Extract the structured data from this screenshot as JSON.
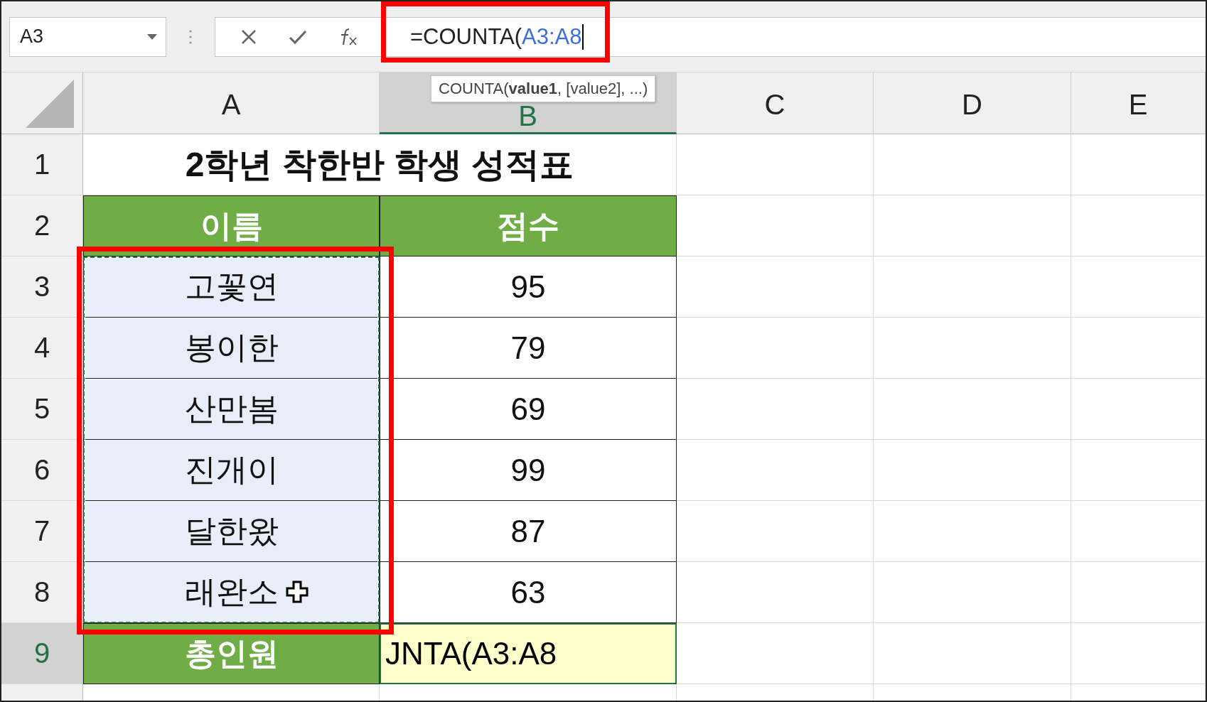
{
  "name_box": {
    "value": "A3"
  },
  "formula_bar": {
    "prefix": "=COUNTA(",
    "reference": "A3:A8",
    "highlighted": true
  },
  "tooltip": "COUNTA(**value1**, [value2], ...)",
  "columns": [
    {
      "label": "A",
      "selected": false
    },
    {
      "label": "B",
      "selected": true
    },
    {
      "label": "C",
      "selected": false
    },
    {
      "label": "D",
      "selected": false
    },
    {
      "label": "E",
      "selected": false
    }
  ],
  "rows": [
    {
      "header": "1",
      "selected": false,
      "kind": "title",
      "cells": [
        "2학년 착한반 학생 성적표"
      ]
    },
    {
      "header": "2",
      "selected": false,
      "kind": "heading",
      "cells": [
        "이름",
        "점수"
      ]
    },
    {
      "header": "3",
      "selected": false,
      "kind": "data",
      "in_range": true,
      "cells": [
        "고꽃연",
        "95"
      ]
    },
    {
      "header": "4",
      "selected": false,
      "kind": "data",
      "in_range": true,
      "cells": [
        "봉이한",
        "79"
      ]
    },
    {
      "header": "5",
      "selected": false,
      "kind": "data",
      "in_range": true,
      "cells": [
        "산만봄",
        "69"
      ]
    },
    {
      "header": "6",
      "selected": false,
      "kind": "data",
      "in_range": true,
      "cells": [
        "진개이",
        "99"
      ]
    },
    {
      "header": "7",
      "selected": false,
      "kind": "data",
      "in_range": true,
      "cells": [
        "달한왔",
        "87"
      ]
    },
    {
      "header": "8",
      "selected": false,
      "kind": "data",
      "in_range": true,
      "cells": [
        "래완소",
        "63"
      ]
    },
    {
      "header": "9",
      "selected": true,
      "kind": "total",
      "cells": [
        "총인원",
        "JNTA(A3:A8"
      ]
    }
  ],
  "range_highlighted": true
}
